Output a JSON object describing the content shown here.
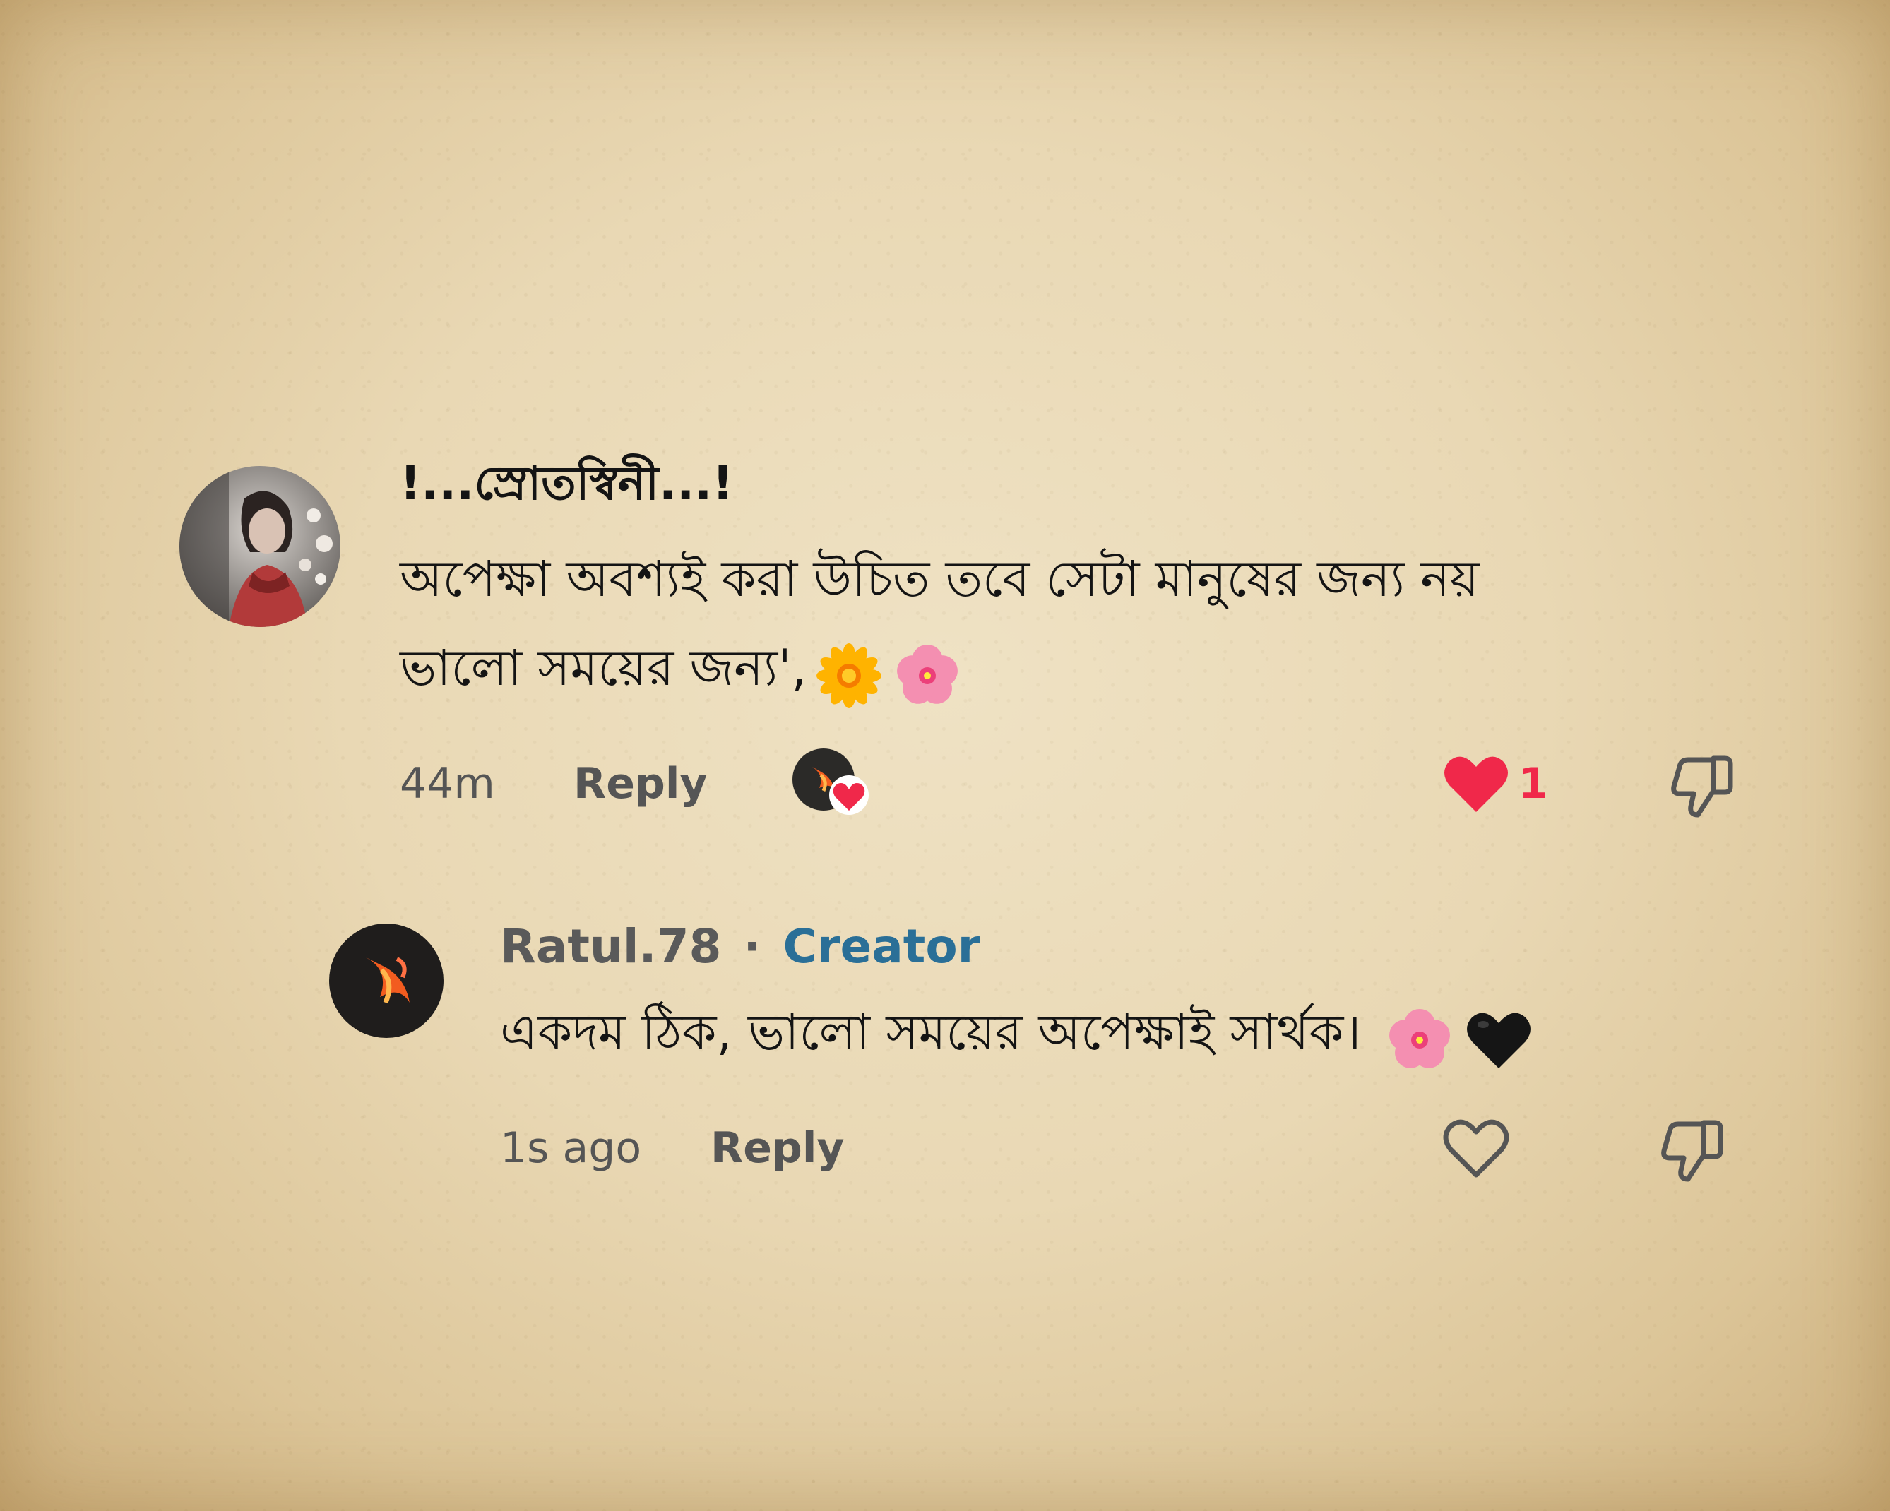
{
  "comment": {
    "username": "!...স্রোতস্বিনী...!",
    "line1": "অপেক্ষা অবশ্যই করা উচিত তবে সেটা মানুষের জন্য নয়",
    "line2": "ভালো সময়ের জন্য',",
    "time": "44m",
    "reply_label": "Reply",
    "like_count": "1",
    "like_color": "#f0284a",
    "icons": [
      "avatar-photo",
      "creator-liked-avatar",
      "heart-icon",
      "thumbs-down-icon",
      "sunflower-emoji",
      "pink-flower-emoji"
    ]
  },
  "reply": {
    "username": "Ratul.78",
    "separator": "·",
    "badge": "Creator",
    "badge_color": "#2a6f97",
    "text": "একদম ঠিক, ভালো সময়ের অপেক্ষাই সার্থক।",
    "time": "1s ago",
    "reply_label": "Reply",
    "icons": [
      "avatar-flame",
      "heart-outline-icon",
      "thumbs-down-icon",
      "pink-flower-emoji",
      "black-heart-emoji"
    ]
  }
}
